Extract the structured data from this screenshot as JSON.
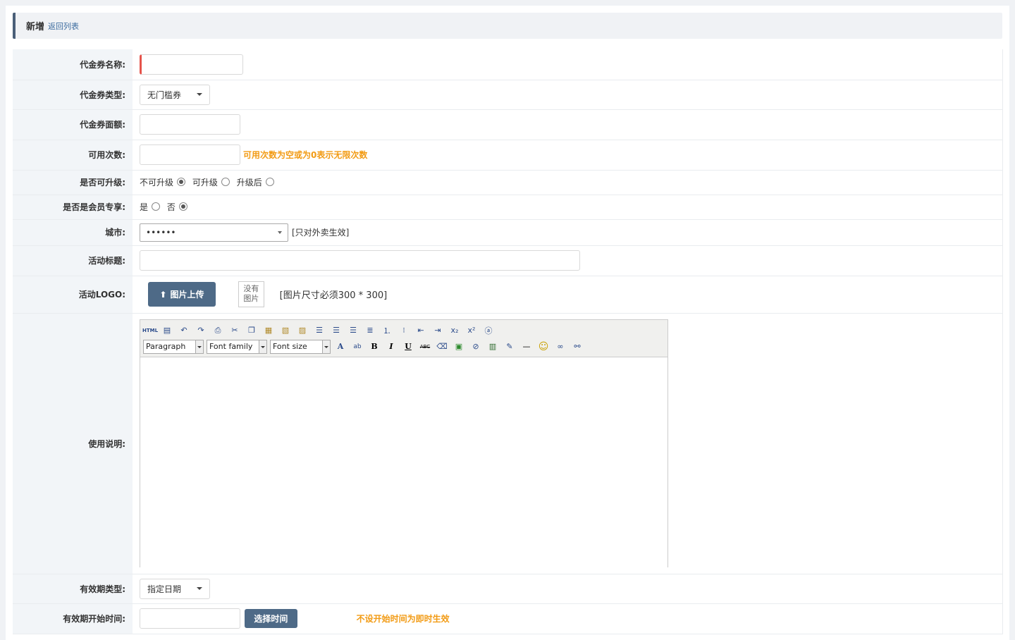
{
  "header": {
    "title": "新增",
    "back_link": "返回列表"
  },
  "fields": {
    "name": {
      "label": "代金券名称:"
    },
    "type": {
      "label": "代金券类型:",
      "selected": "无门槛券"
    },
    "amount": {
      "label": "代金券面额:"
    },
    "usage": {
      "label": "可用次数:",
      "hint": "可用次数为空或为0表示无限次数"
    },
    "upgrade": {
      "label": "是否可升级:",
      "options": [
        "不可升级",
        "可升级",
        "升级后"
      ],
      "selected_index": 0
    },
    "member": {
      "label": "是否是会员专享:",
      "options": [
        "是",
        "否"
      ],
      "selected_index": 1
    },
    "city": {
      "label": "城市:",
      "selected": "••••••",
      "note": "[只对外卖生效]"
    },
    "title": {
      "label": "活动标题:"
    },
    "logo": {
      "label": "活动LOGO:",
      "upload_label": "图片上传",
      "no_pic_line1": "没有",
      "no_pic_line2": "图片",
      "size_note": "[图片尺寸必须300 * 300]"
    },
    "desc": {
      "label": "使用说明:",
      "paragraph": "Paragraph",
      "font_family": "Font family",
      "font_size": "Font size"
    },
    "validity_type": {
      "label": "有效期类型:",
      "selected": "指定日期"
    },
    "start_time": {
      "label": "有效期开始时间:",
      "button": "选择时间",
      "hint": "不设开始时间为即时生效"
    }
  }
}
